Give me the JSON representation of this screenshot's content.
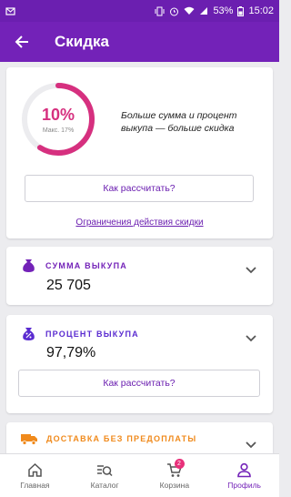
{
  "status_bar": {
    "battery": "53%",
    "time": "15:02"
  },
  "header": {
    "title": "Скидка"
  },
  "discount_card": {
    "percent": "10%",
    "max_label": "Макс. 17%",
    "progress_fraction": 0.59,
    "info_text": "Больше сумма и процент выкупа — больше скидка",
    "how_button": "Как рассчитать?",
    "limits_link": "Ограничения действия скидки"
  },
  "sum_card": {
    "label": "СУММА ВЫКУПА",
    "value": "25 705",
    "color": "#7322b8"
  },
  "percent_card": {
    "label": "ПРОЦЕНТ ВЫКУПА",
    "value": "97,79%",
    "how_button": "Как рассчитать?",
    "color": "#5a2bd0"
  },
  "delivery_card": {
    "label": "ДОСТАВКА БЕЗ ПРЕДОПЛАТЫ",
    "color": "#f08a1c"
  },
  "bottom_nav": {
    "items": [
      {
        "label": "Главная",
        "icon": "home-icon"
      },
      {
        "label": "Каталог",
        "icon": "catalog-search-icon"
      },
      {
        "label": "Корзина",
        "icon": "cart-icon",
        "badge": "2"
      },
      {
        "label": "Профиль",
        "icon": "profile-icon"
      }
    ]
  },
  "colors": {
    "primary": "#7322b8",
    "accent": "#d6307f"
  }
}
